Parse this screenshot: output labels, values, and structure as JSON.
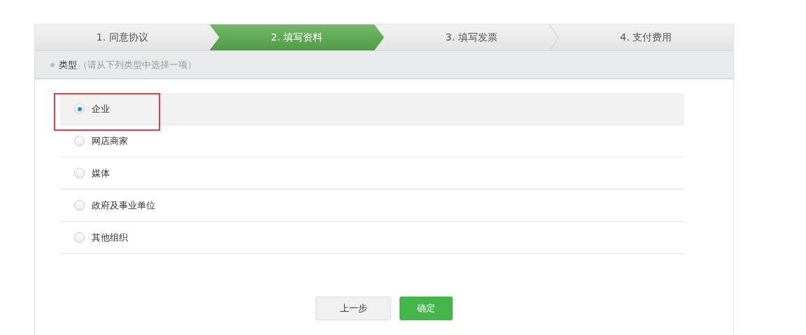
{
  "steps": [
    {
      "label": "1. 同意协议",
      "selected": false
    },
    {
      "label": "2. 填写资料",
      "selected": true
    },
    {
      "label": "3. 填写发票",
      "selected": false
    },
    {
      "label": "4. 支付费用",
      "selected": false
    }
  ],
  "section": {
    "title": "类型",
    "hint": "（请从下列类型中选择一项）"
  },
  "options": [
    {
      "label": "企业",
      "selected": true,
      "highlighted": true
    },
    {
      "label": "网店商家",
      "selected": false,
      "highlighted": false
    },
    {
      "label": "媒体",
      "selected": false,
      "highlighted": false
    },
    {
      "label": "政府及事业单位",
      "selected": false,
      "highlighted": false
    },
    {
      "label": "其他组织",
      "selected": false,
      "highlighted": false
    }
  ],
  "buttons": [
    {
      "label": "上一步",
      "kind": "secondary"
    },
    {
      "label": "确定",
      "kind": "primary"
    }
  ]
}
